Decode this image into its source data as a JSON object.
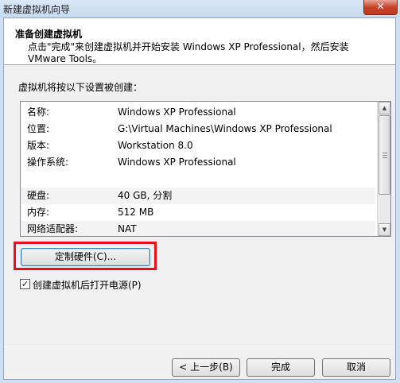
{
  "window": {
    "title": "新建虚拟机向导",
    "close_glyph": "✕"
  },
  "header": {
    "title": "准备创建虚拟机",
    "description": "点击\"完成\"来创建虚拟机并开始安装 Windows XP Professional，然后安装 VMware Tools。"
  },
  "summary": {
    "label": "虚拟机将按以下设置被创建：",
    "rows": [
      {
        "key": "名称:",
        "value": "Windows XP Professional"
      },
      {
        "key": "位置:",
        "value": "G:\\Virtual Machines\\Windows XP Professional"
      },
      {
        "key": "版本:",
        "value": "Workstation 8.0"
      },
      {
        "key": "操作系统:",
        "value": "Windows XP Professional"
      },
      {
        "key": "",
        "value": ""
      },
      {
        "key": "硬盘:",
        "value": "40 GB, 分割"
      },
      {
        "key": "内存:",
        "value": "512 MB"
      },
      {
        "key": "网络适配器:",
        "value": "NAT"
      }
    ],
    "scroll_up_glyph": "▲",
    "scroll_down_glyph": "▼"
  },
  "customize_button": "定制硬件(C)...",
  "power_on": {
    "checked_glyph": "✓",
    "label": "创建虚拟机后打开电源(P)"
  },
  "buttons": {
    "back": "< 上一步(B)",
    "finish": "完成",
    "cancel": "取消"
  },
  "colors": {
    "highlight": "#e8101a",
    "title_bar": "#cfe0f4"
  }
}
